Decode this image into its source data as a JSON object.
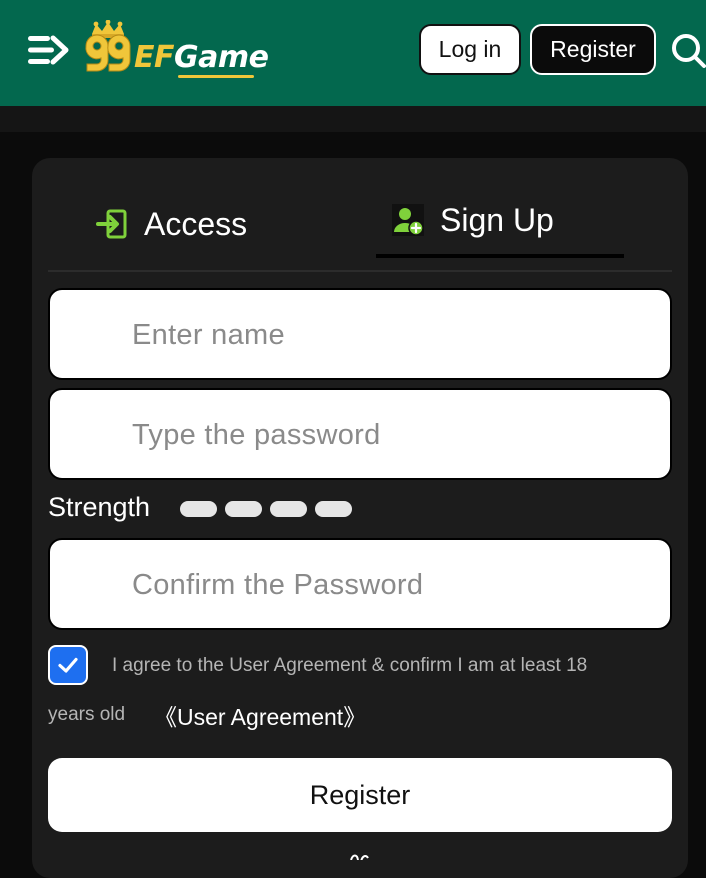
{
  "header": {
    "logo_text_ef": "EF",
    "logo_text_game": "Game",
    "login_label": "Log in",
    "register_label": "Register",
    "menu_icon": "menu-arrow-icon",
    "search_icon": "search-icon",
    "background_color": "#03684e"
  },
  "tabs": [
    {
      "label": "Access",
      "icon": "login-arrow-icon",
      "active": false
    },
    {
      "label": "Sign Up",
      "icon": "add-user-icon",
      "active": true
    }
  ],
  "form": {
    "name_placeholder": "Enter name",
    "password_placeholder": "Type the password",
    "confirm_placeholder": "Confirm the Password",
    "strength_label": "Strength",
    "strength_levels": 4,
    "agreement_text_1": "I agree to the User Agreement & confirm I am at least 18",
    "agreement_text_2": "years old",
    "agreement_link": "《User Agreement》",
    "agreement_checked": true,
    "submit_label": "Register"
  },
  "colors": {
    "accent_green": "#03684e",
    "gold": "#f0c63a",
    "checkbox_blue": "#1e6ff0"
  }
}
